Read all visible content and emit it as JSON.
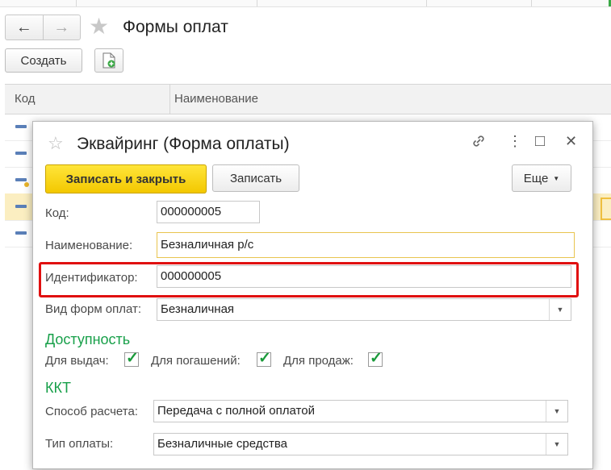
{
  "main": {
    "title": "Формы оплат",
    "create_label": "Создать",
    "columns": [
      "Код",
      "Наименование"
    ]
  },
  "dialog": {
    "title": "Эквайринг (Форма оплаты)",
    "save_close_label": "Записать и закрыть",
    "save_label": "Записать",
    "more_label": "Еще",
    "fields": {
      "code": {
        "label": "Код:",
        "value": "000000005"
      },
      "name": {
        "label": "Наименование:",
        "value": "Безналичная р/с"
      },
      "identifier": {
        "label": "Идентификатор:",
        "value": "000000005"
      },
      "payment_form_type": {
        "label": "Вид форм оплат:",
        "value": "Безналичная"
      }
    },
    "availability": {
      "title": "Доступность",
      "issue": {
        "label": "Для выдач:",
        "checked": true
      },
      "repayment": {
        "label": "Для погашений:",
        "checked": true
      },
      "sales": {
        "label": "Для продаж:",
        "checked": true
      }
    },
    "kkt": {
      "title": "ККТ",
      "calc_method": {
        "label": "Способ расчета:",
        "value": "Передача с полной оплатой"
      },
      "payment_type": {
        "label": "Тип оплаты:",
        "value": "Безналичные средства"
      }
    }
  },
  "icons": {
    "back": "←",
    "forward": "→",
    "favorite": "★",
    "favorite_outline": "☆",
    "link": "🔗",
    "more_vertical": "⋮",
    "maximize": "□",
    "close": "✕",
    "dropdown": "▼",
    "check": "✓"
  },
  "colors": {
    "accent_green": "#18a04a",
    "primary_yellow": "#f5d01e",
    "highlight_red": "#e01010"
  }
}
